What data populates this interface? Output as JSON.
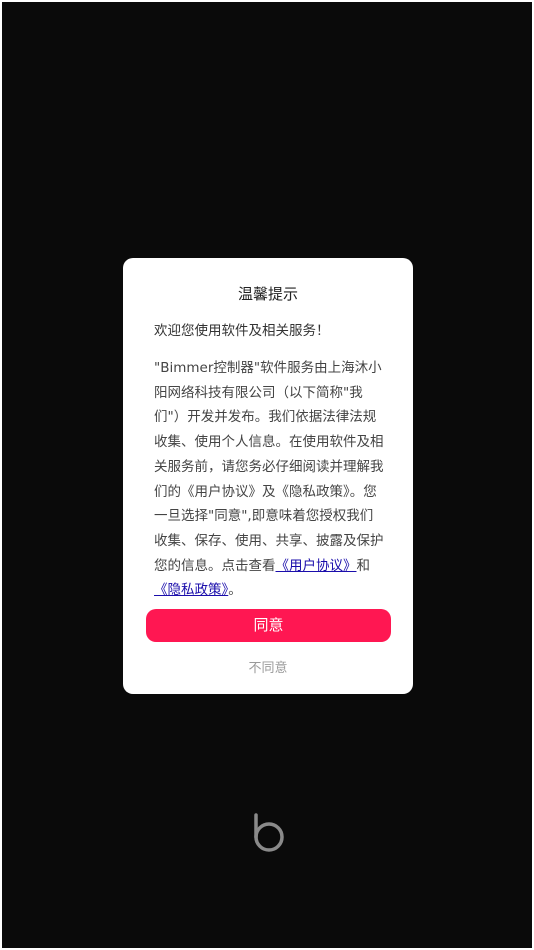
{
  "dialog": {
    "title": "温馨提示",
    "welcome": "欢迎您使用软件及相关服务！",
    "body_prefix": "\"Bimmer控制器\"软件服务由上海沐小阳网络科技有限公司（以下简称\"我们\"）开发并发布。我们依据法律法规收集、使用个人信息。在使用软件及相关服务前，请您务必仔细阅读并理解我们的《用户协议》及《隐私政策》。您一旦选择\"同意\",即意味着您授权我们收集、保存、使用、共享、披露及保护您的信息。点击查看",
    "user_agreement_link": "《用户协议》",
    "and_text": "和",
    "privacy_policy_link": "《隐私政策》",
    "end_period": "。",
    "agree_label": "同意",
    "disagree_label": "不同意"
  },
  "colors": {
    "background": "#0a0a0a",
    "dialog": "#ffffff",
    "accent": "#ff1752",
    "link": "#1a0dab",
    "logo": "#8a8a8a"
  },
  "logo": {
    "icon": "bimmer-b-logo-icon"
  }
}
